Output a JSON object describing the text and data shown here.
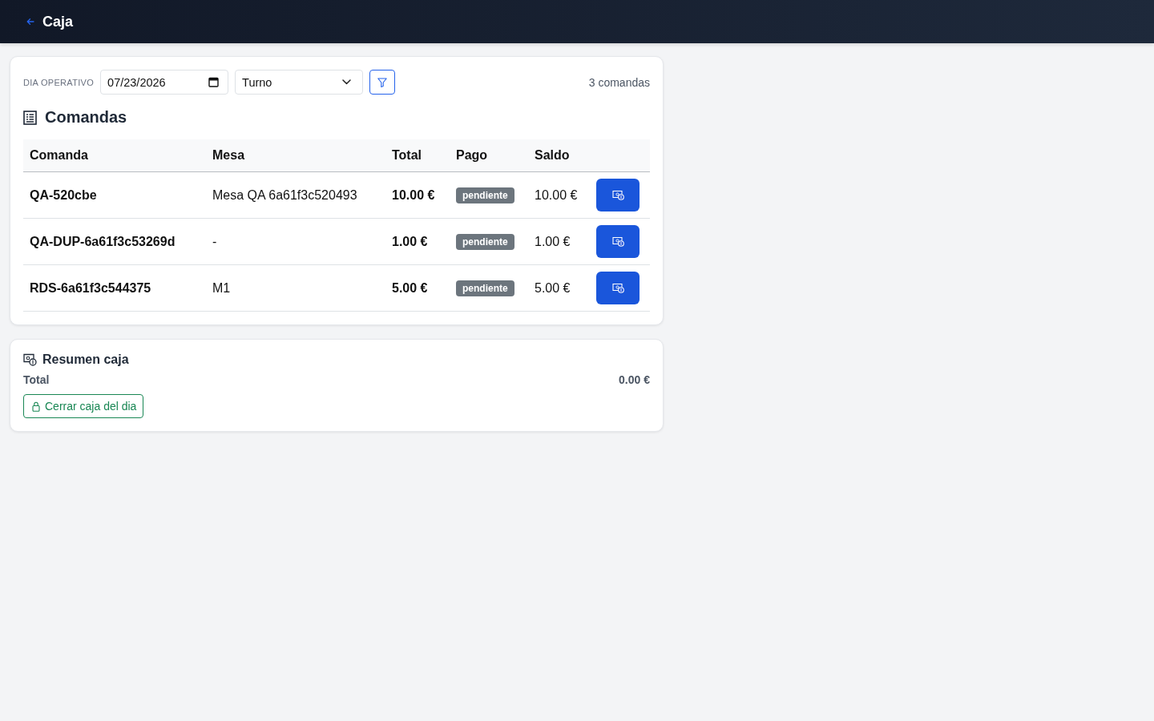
{
  "header": {
    "title": "Caja"
  },
  "filters": {
    "label": "DIA OPERATIVO",
    "date": {
      "value": "07/23/2026"
    },
    "shift": {
      "value": "Turno"
    },
    "count": "3 comandas"
  },
  "orders": {
    "title": "Comandas",
    "columns": [
      "Comanda",
      "Mesa",
      "Total",
      "Pago",
      "Saldo"
    ],
    "rows": [
      {
        "comanda": "QA-520cbe",
        "mesa": "Mesa QA 6a61f3c520493",
        "total": "10.00 €",
        "pago": "pendiente",
        "saldo": "10.00 €"
      },
      {
        "comanda": "QA-DUP-6a61f3c53269d",
        "mesa": "-",
        "total": "1.00 €",
        "pago": "pendiente",
        "saldo": "1.00 €"
      },
      {
        "comanda": "RDS-6a61f3c544375",
        "mesa": "M1",
        "total": "5.00 €",
        "pago": "pendiente",
        "saldo": "5.00 €"
      }
    ]
  },
  "summary": {
    "title": "Resumen caja",
    "total_label": "Total",
    "total_value": "0.00 €",
    "close_button": "Cerrar caja del dia"
  }
}
